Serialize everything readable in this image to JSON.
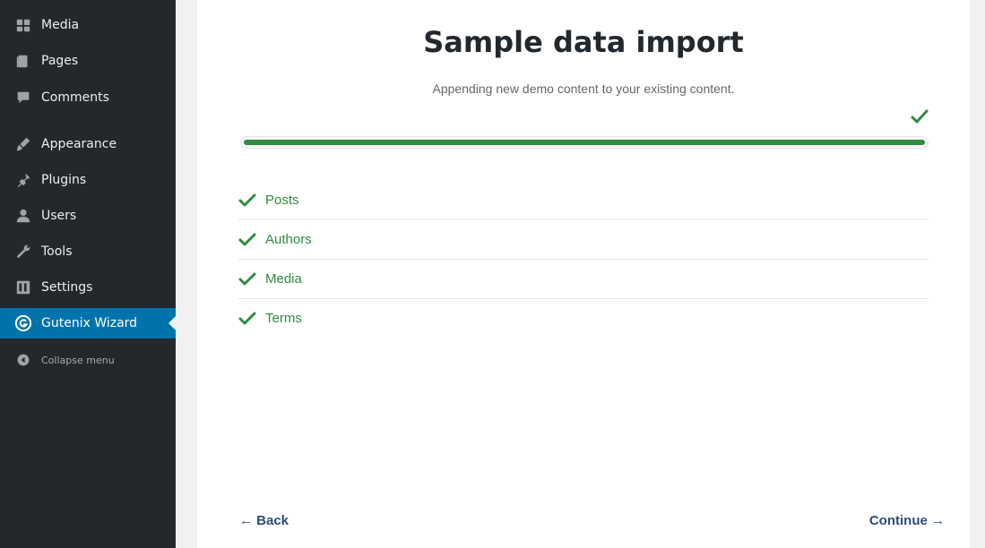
{
  "sidebar": {
    "items": [
      {
        "label": "Media",
        "icon": "media-icon"
      },
      {
        "label": "Pages",
        "icon": "pages-icon"
      },
      {
        "label": "Comments",
        "icon": "comments-icon"
      },
      {
        "label": "Appearance",
        "icon": "appearance-icon"
      },
      {
        "label": "Plugins",
        "icon": "plugins-icon"
      },
      {
        "label": "Users",
        "icon": "users-icon"
      },
      {
        "label": "Tools",
        "icon": "tools-icon"
      },
      {
        "label": "Settings",
        "icon": "settings-icon"
      },
      {
        "label": "Gutenix Wizard",
        "icon": "gutenix-icon",
        "active": true
      },
      {
        "label": "Collapse menu",
        "icon": "collapse-icon"
      }
    ]
  },
  "main": {
    "title": "Sample data import",
    "subtitle": "Appending new demo content to your existing content.",
    "progress": 1.0,
    "steps": [
      {
        "label": "Posts",
        "status": "done"
      },
      {
        "label": "Authors",
        "status": "done"
      },
      {
        "label": "Media",
        "status": "done"
      },
      {
        "label": "Terms",
        "status": "done"
      }
    ],
    "back_label": "← Back",
    "continue_label": "Continue →"
  },
  "colors": {
    "sidebar_bg": "#23282d",
    "active_bg": "#0073aa",
    "success_green": "#2e8b40",
    "link_blue": "#2d4b7a"
  }
}
